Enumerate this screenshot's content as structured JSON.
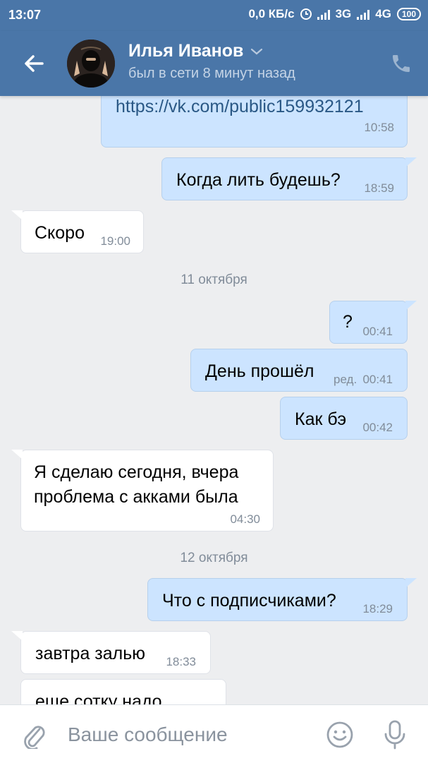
{
  "status_bar": {
    "time": "13:07",
    "speed": "0,0 КБ/с",
    "network_1": "3G",
    "network_2": "4G",
    "battery": "100"
  },
  "header": {
    "contact_name": "Илья Иванов",
    "contact_status": "был в сети 8 минут назад"
  },
  "messages": [
    {
      "dir": "out",
      "text": "https://vk.com/public159932121",
      "time": "10:58"
    },
    {
      "dir": "out",
      "text": "Когда лить будешь?",
      "time": "18:59"
    },
    {
      "dir": "in",
      "text": "Скоро",
      "time": "19:00"
    },
    {
      "date": "11 октября"
    },
    {
      "dir": "out",
      "text": "?",
      "time": "00:41"
    },
    {
      "dir": "out",
      "text": "День прошёл",
      "edited": "ред.",
      "time": "00:41"
    },
    {
      "dir": "out",
      "text": "Как бэ",
      "time": "00:42"
    },
    {
      "dir": "in",
      "text_lines": [
        "Я сделаю сегодня, вчера",
        "проблема с акками была"
      ],
      "time": "04:30"
    },
    {
      "date": "12 октября"
    },
    {
      "dir": "out",
      "text": "Что с подписчиками?",
      "time": "18:29"
    },
    {
      "dir": "in",
      "text": "завтра залью",
      "time": "18:33"
    },
    {
      "dir": "in",
      "text": "еще сотку надо"
    }
  ],
  "composer": {
    "placeholder": "Ваше сообщение"
  },
  "colors": {
    "brand": "#4a76a8",
    "outgoing_bubble": "#cce4ff",
    "incoming_bubble": "#ffffff",
    "background": "#edeef0",
    "link": "#2a5885"
  }
}
